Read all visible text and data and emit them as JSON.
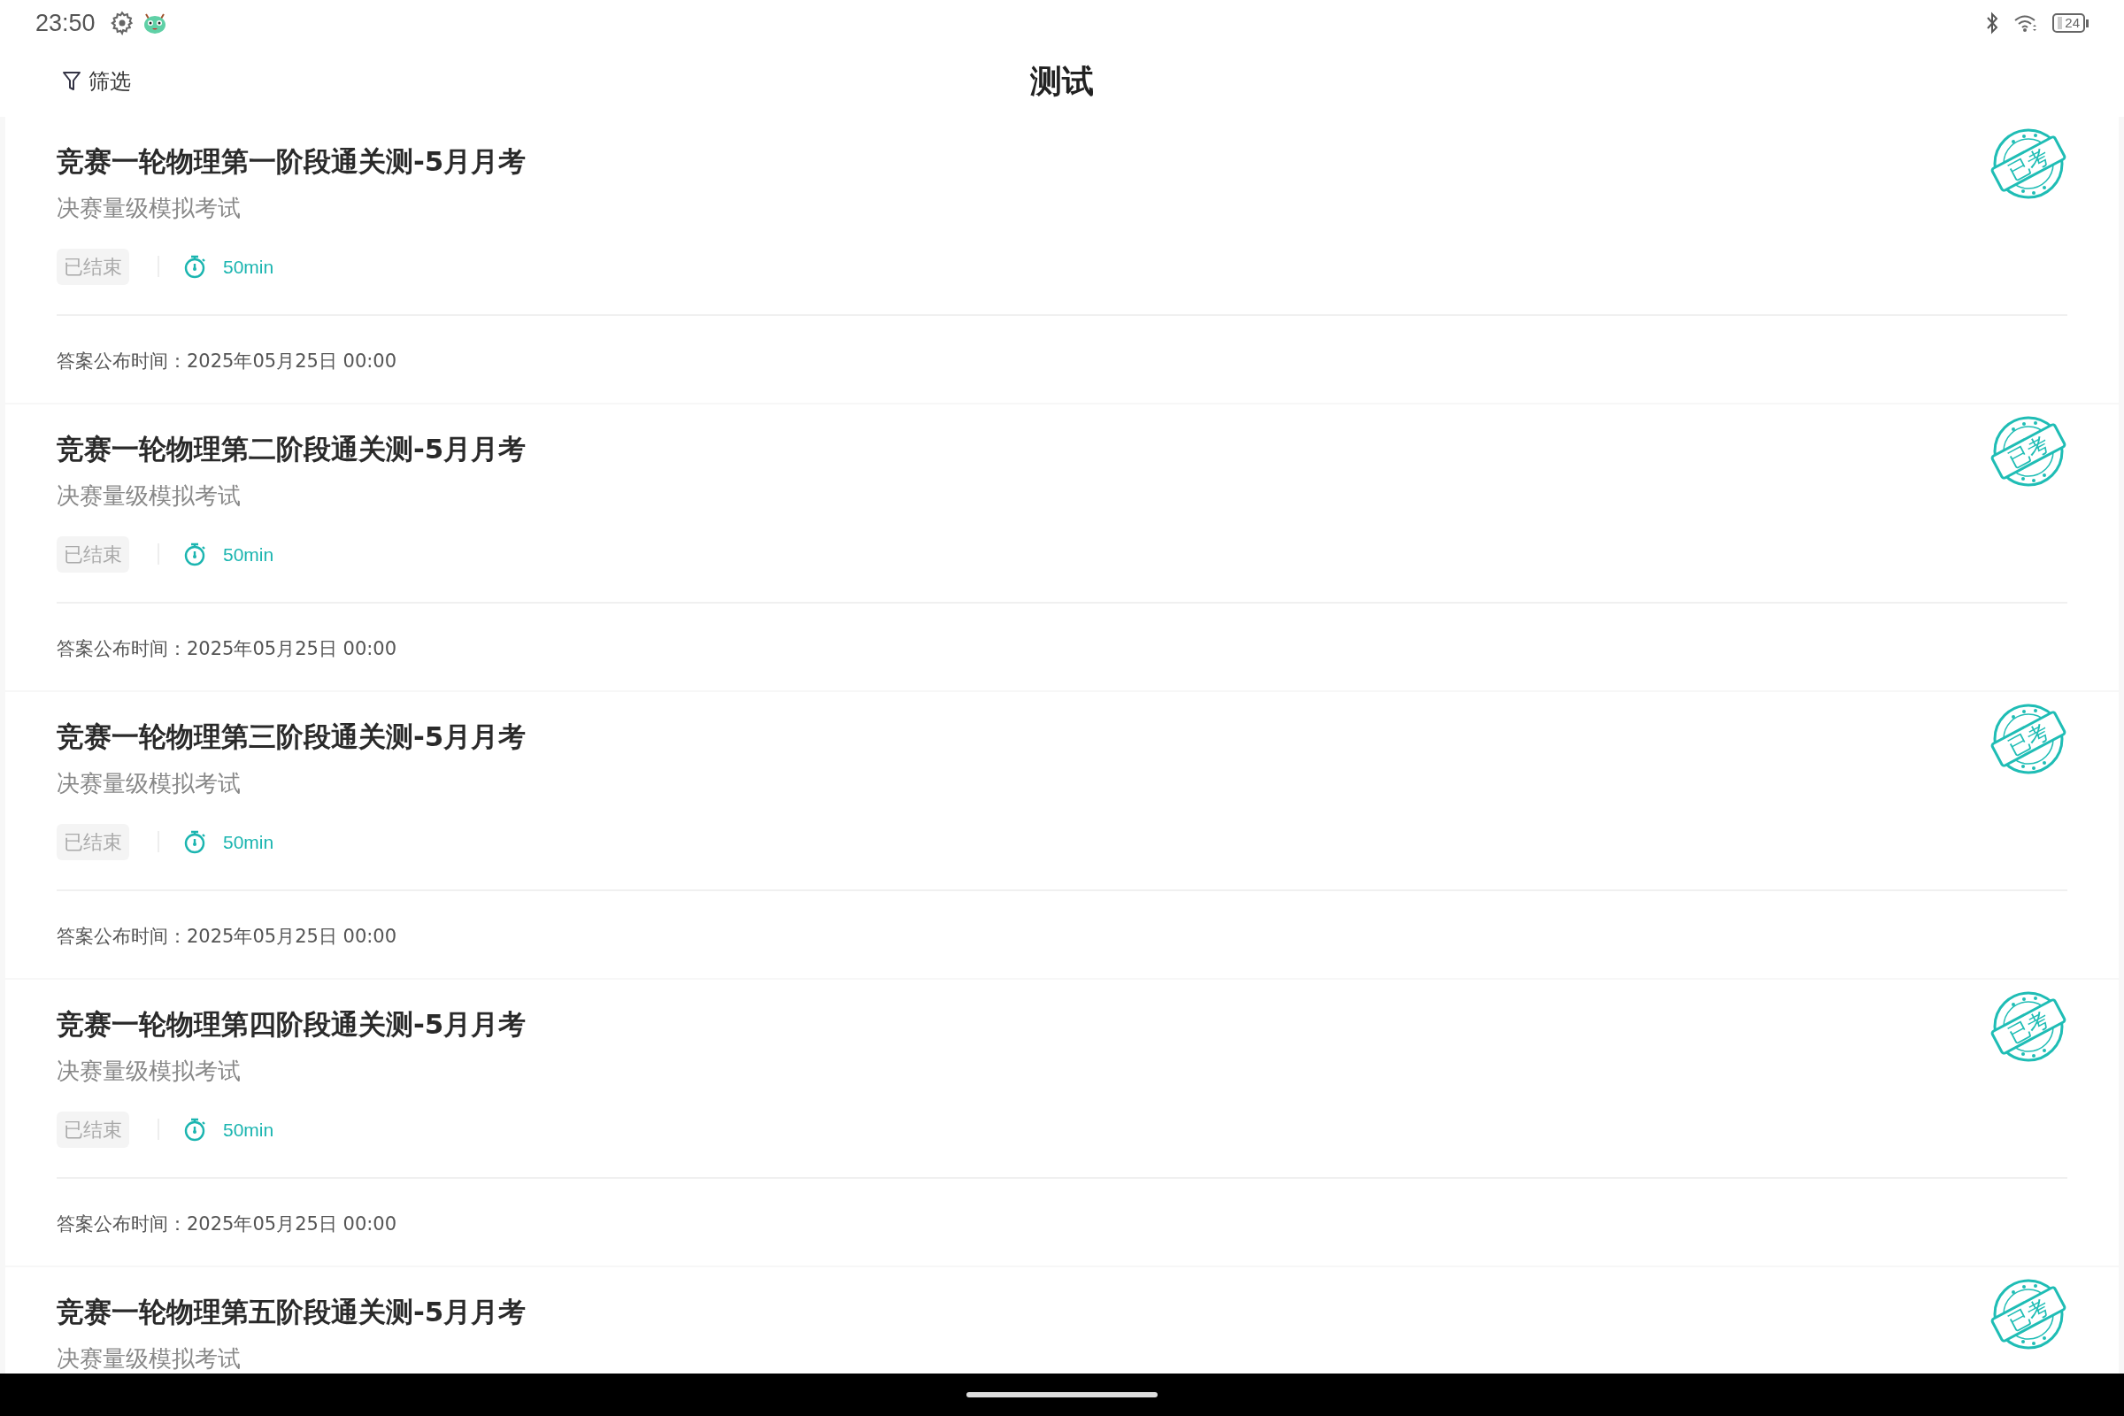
{
  "status_bar": {
    "time": "23:50",
    "battery": "24"
  },
  "header": {
    "filter_label": "筛选",
    "title": "测试"
  },
  "exams": [
    {
      "title": "竞赛一轮物理第一阶段通关测-5月月考",
      "subtitle": "决赛量级模拟考试",
      "status": "已结束",
      "duration": "50min",
      "answer_time": "答案公布时间：2025年05月25日 00:00",
      "stamp": "已考"
    },
    {
      "title": "竞赛一轮物理第二阶段通关测-5月月考",
      "subtitle": "决赛量级模拟考试",
      "status": "已结束",
      "duration": "50min",
      "answer_time": "答案公布时间：2025年05月25日 00:00",
      "stamp": "已考"
    },
    {
      "title": "竞赛一轮物理第三阶段通关测-5月月考",
      "subtitle": "决赛量级模拟考试",
      "status": "已结束",
      "duration": "50min",
      "answer_time": "答案公布时间：2025年05月25日 00:00",
      "stamp": "已考"
    },
    {
      "title": "竞赛一轮物理第四阶段通关测-5月月考",
      "subtitle": "决赛量级模拟考试",
      "status": "已结束",
      "duration": "50min",
      "answer_time": "答案公布时间：2025年05月25日 00:00",
      "stamp": "已考"
    },
    {
      "title": "竞赛一轮物理第五阶段通关测-5月月考",
      "subtitle": "决赛量级模拟考试",
      "stamp": "已考"
    }
  ]
}
